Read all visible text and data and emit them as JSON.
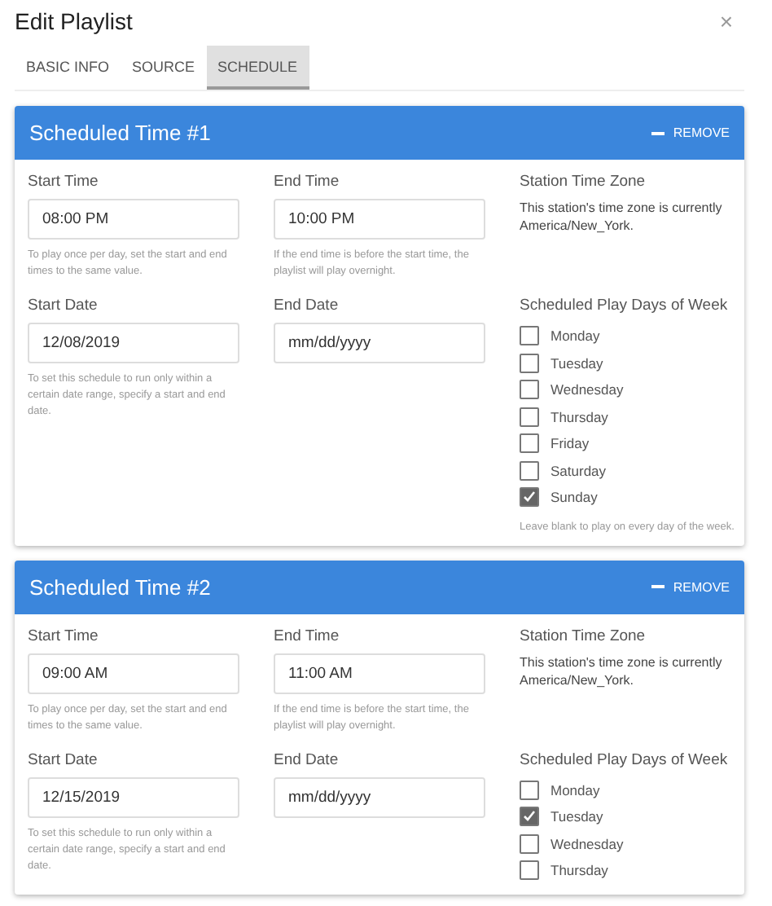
{
  "dialog": {
    "title": "Edit Playlist",
    "close": "×"
  },
  "tabs": [
    {
      "label": "BASIC INFO",
      "selected": false
    },
    {
      "label": "SOURCE",
      "selected": false
    },
    {
      "label": "SCHEDULE",
      "selected": true
    }
  ],
  "schedules": [
    {
      "title": "Scheduled Time #1",
      "remove": "REMOVE",
      "start_time": {
        "label": "Start Time",
        "value": "08:00 PM",
        "help": "To play once per day, set the start and end times to the same value."
      },
      "end_time": {
        "label": "End Time",
        "value": "10:00 PM",
        "help": "If the end time is before the start time, the playlist will play overnight."
      },
      "time_zone": {
        "label": "Station Time Zone",
        "text": "This station's time zone is currently America/New_York."
      },
      "start_date": {
        "label": "Start Date",
        "value": "12/08/2019",
        "help": "To set this schedule to run only within a certain date range, specify a start and end date."
      },
      "end_date": {
        "label": "End Date",
        "placeholder": "mm/dd/yyyy"
      },
      "days": {
        "label": "Scheduled Play Days of Week",
        "help": "Leave blank to play on every day of the week.",
        "items": [
          {
            "label": "Monday",
            "checked": false
          },
          {
            "label": "Tuesday",
            "checked": false
          },
          {
            "label": "Wednesday",
            "checked": false
          },
          {
            "label": "Thursday",
            "checked": false
          },
          {
            "label": "Friday",
            "checked": false
          },
          {
            "label": "Saturday",
            "checked": false
          },
          {
            "label": "Sunday",
            "checked": true
          }
        ]
      }
    },
    {
      "title": "Scheduled Time #2",
      "remove": "REMOVE",
      "start_time": {
        "label": "Start Time",
        "value": "09:00 AM",
        "help": "To play once per day, set the start and end times to the same value."
      },
      "end_time": {
        "label": "End Time",
        "value": "11:00 AM",
        "help": "If the end time is before the start time, the playlist will play overnight."
      },
      "time_zone": {
        "label": "Station Time Zone",
        "text": "This station's time zone is currently America/New_York."
      },
      "start_date": {
        "label": "Start Date",
        "value": "12/15/2019",
        "help": "To set this schedule to run only within a certain date range, specify a start and end date."
      },
      "end_date": {
        "label": "End Date",
        "placeholder": "mm/dd/yyyy"
      },
      "days": {
        "label": "Scheduled Play Days of Week",
        "items": [
          {
            "label": "Monday",
            "checked": false
          },
          {
            "label": "Tuesday",
            "checked": true
          },
          {
            "label": "Wednesday",
            "checked": false
          },
          {
            "label": "Thursday",
            "checked": false
          }
        ]
      }
    }
  ]
}
